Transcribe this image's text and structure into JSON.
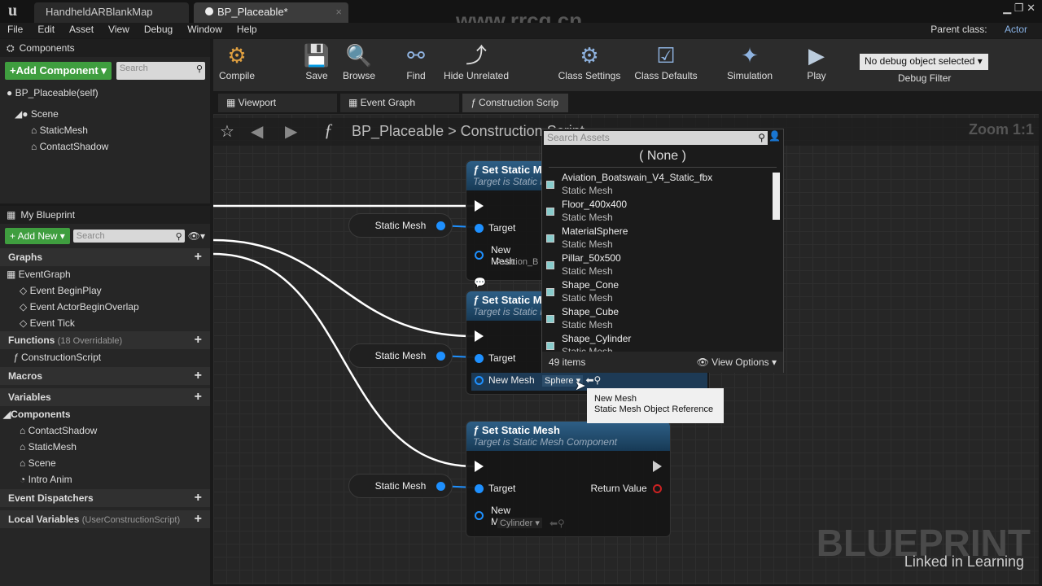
{
  "window": {
    "tabs": [
      "HandheldARBlankMap",
      "BP_Placeable*"
    ],
    "parent_class_label": "Parent class:",
    "parent_class": "Actor",
    "watermark": "www.rrcg.cn"
  },
  "menu": [
    "File",
    "Edit",
    "Asset",
    "View",
    "Debug",
    "Window",
    "Help"
  ],
  "components": {
    "title": "Components",
    "add_button": "+Add Component",
    "search_placeholder": "Search",
    "self": "BP_Placeable(self)",
    "tree": [
      "Scene",
      "StaticMesh",
      "ContactShadow"
    ]
  },
  "my_blueprint": {
    "title": "My Blueprint",
    "add_button": "+ Add New",
    "search_placeholder": "Search",
    "graphs_label": "Graphs",
    "graphs": [
      "EventGraph",
      "Event BeginPlay",
      "Event ActorBeginOverlap",
      "Event Tick"
    ],
    "functions_label": "Functions",
    "functions_note": "(18 Overridable)",
    "functions": [
      "ConstructionScript"
    ],
    "macros_label": "Macros",
    "variables_label": "Variables",
    "components_label": "Components",
    "component_vars": [
      "ContactShadow",
      "StaticMesh",
      "Scene",
      "Intro Anim"
    ],
    "dispatchers_label": "Event Dispatchers",
    "local_label": "Local Variables",
    "local_note": "(UserConstructionScript)"
  },
  "toolbar": {
    "items": [
      "Compile",
      "Save",
      "Browse",
      "Find",
      "Hide Unrelated",
      "Class Settings",
      "Class Defaults",
      "Simulation",
      "Play"
    ],
    "debug_select": "No debug object selected",
    "debug_label": "Debug Filter"
  },
  "graph_tabs": [
    "Viewport",
    "Event Graph",
    "Construction Scrip"
  ],
  "breadcrumb": {
    "root": "BP_Placeable",
    "sep": ">",
    "current": "Construction Script",
    "zoom": "Zoom 1:1"
  },
  "nodes": [
    {
      "title": "Set Static Mesh",
      "subtitle": "Target is Static Mesh Component",
      "target": "Target",
      "new_mesh": "New Mesh",
      "value": "Aviation_B"
    },
    {
      "title": "Set Static Mesh",
      "subtitle": "Target is Static Mesh Component",
      "target": "Target",
      "new_mesh": "New Mesh",
      "value": "Sphere"
    },
    {
      "title": "Set Static Mesh",
      "subtitle": "Target is Static Mesh Component",
      "target": "Target",
      "new_mesh": "New Mesh",
      "value": "Cylinder",
      "return": "Return Value"
    }
  ],
  "getter_label": "Static Mesh",
  "asset_picker": {
    "search_placeholder": "Search Assets",
    "none": "( None )",
    "items": [
      {
        "name": "Aviation_Boatswain_V4_Static_fbx",
        "type": "Static Mesh"
      },
      {
        "name": "Floor_400x400",
        "type": "Static Mesh"
      },
      {
        "name": "MaterialSphere",
        "type": "Static Mesh"
      },
      {
        "name": "Pillar_50x500",
        "type": "Static Mesh"
      },
      {
        "name": "Shape_Cone",
        "type": "Static Mesh"
      },
      {
        "name": "Shape_Cube",
        "type": "Static Mesh"
      },
      {
        "name": "Shape_Cylinder",
        "type": "Static Mesh"
      }
    ],
    "count": "49 items",
    "view_options": "View Options"
  },
  "tooltip": {
    "line1": "New Mesh",
    "line2": "Static Mesh Object Reference"
  },
  "overlay": {
    "blueprint": "BLUEPRINT",
    "linkedin": "Linked in Learning"
  }
}
